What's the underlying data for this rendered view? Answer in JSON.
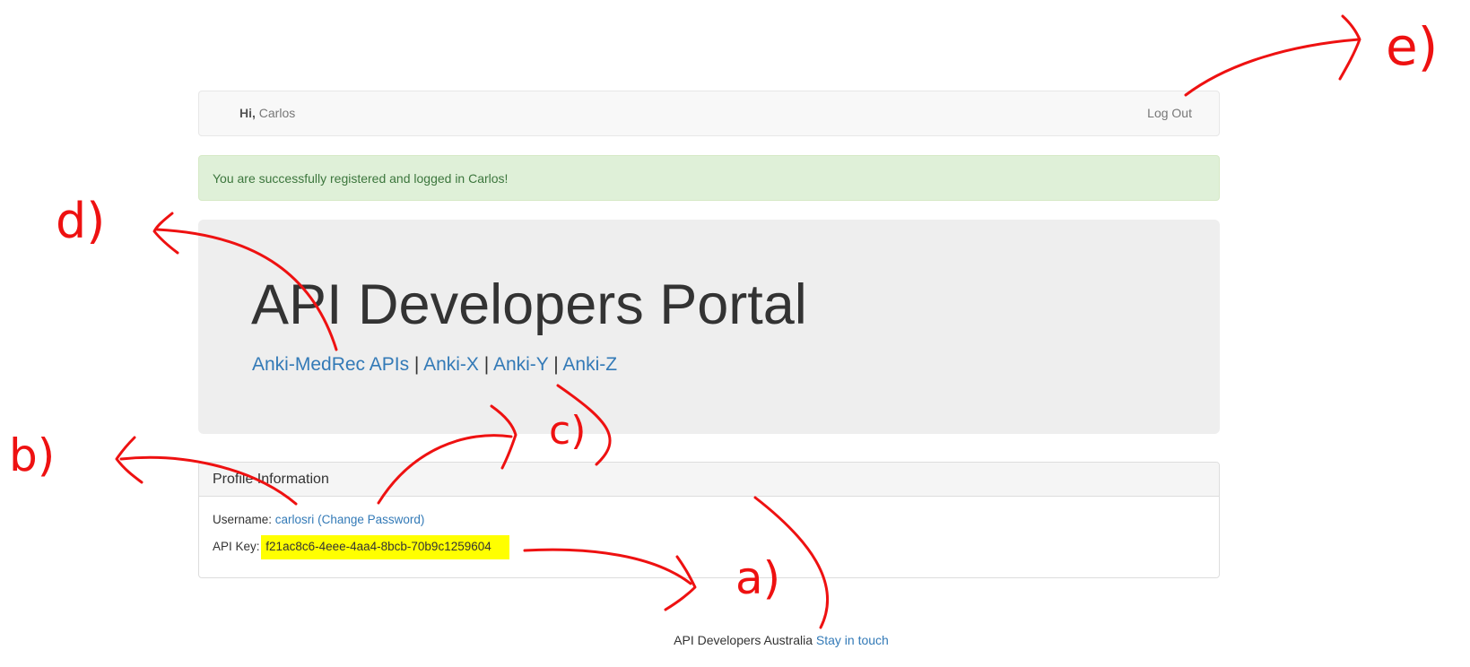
{
  "navbar": {
    "greeting_prefix": "Hi,",
    "user_name": "Carlos",
    "logout_label": "Log Out"
  },
  "alert": {
    "message": "You are successfully registered and logged in Carlos!"
  },
  "jumbotron": {
    "title": "API Developers Portal",
    "links": [
      {
        "label": "Anki-MedRec APIs"
      },
      {
        "label": "Anki-X"
      },
      {
        "label": "Anki-Y"
      },
      {
        "label": "Anki-Z"
      }
    ],
    "separator": "|"
  },
  "profile": {
    "heading": "Profile Information",
    "username_label": "Username:",
    "username_value": "carlosri",
    "change_password_label": "(Change Password)",
    "api_key_label": "API Key:",
    "api_key_value": "f21ac8c6-4eee-4aa4-8bcb-70b9c1259604"
  },
  "footer": {
    "text": "API Developers Australia",
    "link_label": "Stay in touch"
  },
  "annotations": {
    "labels": [
      "a)",
      "b)",
      "c)",
      "d)",
      "e)"
    ],
    "color": "#ee1111",
    "highlight_color": "#ffff00"
  }
}
